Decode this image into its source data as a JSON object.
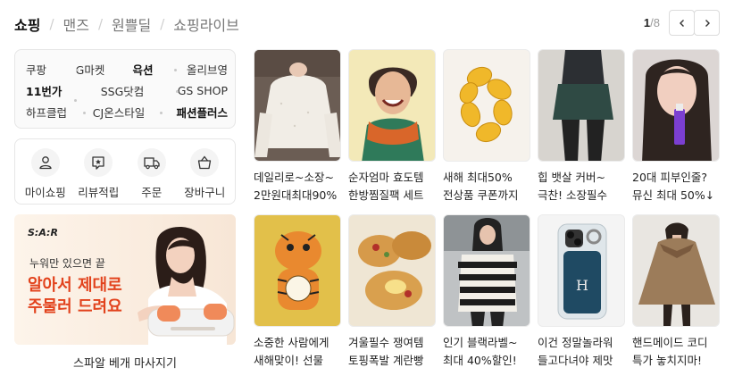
{
  "tabs": [
    {
      "label": "쇼핑",
      "active": true
    },
    {
      "label": "맨즈",
      "active": false
    },
    {
      "label": "원쁠딜",
      "active": false
    },
    {
      "label": "쇼핑라이브",
      "active": false
    }
  ],
  "pager": {
    "current": "1",
    "total": "/8",
    "prev_icon": "chevron-left-icon",
    "next_icon": "chevron-right-icon"
  },
  "malls": [
    {
      "label": "쿠팡",
      "strong": false
    },
    {
      "label": "G마켓",
      "strong": false
    },
    {
      "label": "옥션",
      "strong": true
    },
    {
      "label": "올리브영",
      "strong": false
    },
    {
      "label": "11번가",
      "strong": true
    },
    {
      "label": "SSG닷컴",
      "strong": false
    },
    {
      "label": "GS SHOP",
      "strong": false
    },
    {
      "label": "하프클럽",
      "strong": false
    },
    {
      "label": "CJ온스타일",
      "strong": false
    },
    {
      "label": "패션플러스",
      "strong": true
    }
  ],
  "quick_menu": [
    {
      "label": "마이쇼핑",
      "icon": "person-icon"
    },
    {
      "label": "리뷰적립",
      "icon": "review-star-icon"
    },
    {
      "label": "주문",
      "icon": "truck-icon"
    },
    {
      "label": "장바구니",
      "icon": "cart-bag-icon"
    }
  ],
  "ad": {
    "logo": "S:A:R",
    "sub": "누워만 있으면 끝",
    "headline": "알아서 제대로\n주물러 드려요",
    "caption": "스파알 베개 마사지기",
    "accent": "#e2421c"
  },
  "products": [
    {
      "line1": "데일리로~소장~",
      "line2": "2만원대최대90%",
      "thumb": "sweater-photo"
    },
    {
      "line1": "순자엄마 효도템",
      "line2": "한방찜질팩 세트",
      "thumb": "woman-heat-pack-photo"
    },
    {
      "line1": "새해 최대50%",
      "line2": "전상품 쿠폰까지",
      "thumb": "gold-bracelet-photo"
    },
    {
      "line1": "힙 뱃살 커버~",
      "line2": "극찬! 소장필수",
      "thumb": "skirt-leggings-photo"
    },
    {
      "line1": "20대 피부인줄?",
      "line2": "뮤신 최대 50%↓",
      "thumb": "skincare-woman-photo"
    },
    {
      "line1": "소중한 사람에게",
      "line2": "새해맞이! 선물",
      "thumb": "tiger-clock-photo"
    },
    {
      "line1": "겨울필수 쟁여템",
      "line2": "토핑폭발 계란빵",
      "thumb": "egg-bread-photo"
    },
    {
      "line1": "인기 블랙라벨~",
      "line2": "최대 40%할인!",
      "thumb": "striped-knit-photo"
    },
    {
      "line1": "이건 정말놀라워",
      "line2": "들고다녀야 제맛",
      "thumb": "phone-case-photo"
    },
    {
      "line1": "핸드메이드 코디",
      "line2": "특가 놓치지마!",
      "thumb": "wool-cape-photo"
    }
  ]
}
